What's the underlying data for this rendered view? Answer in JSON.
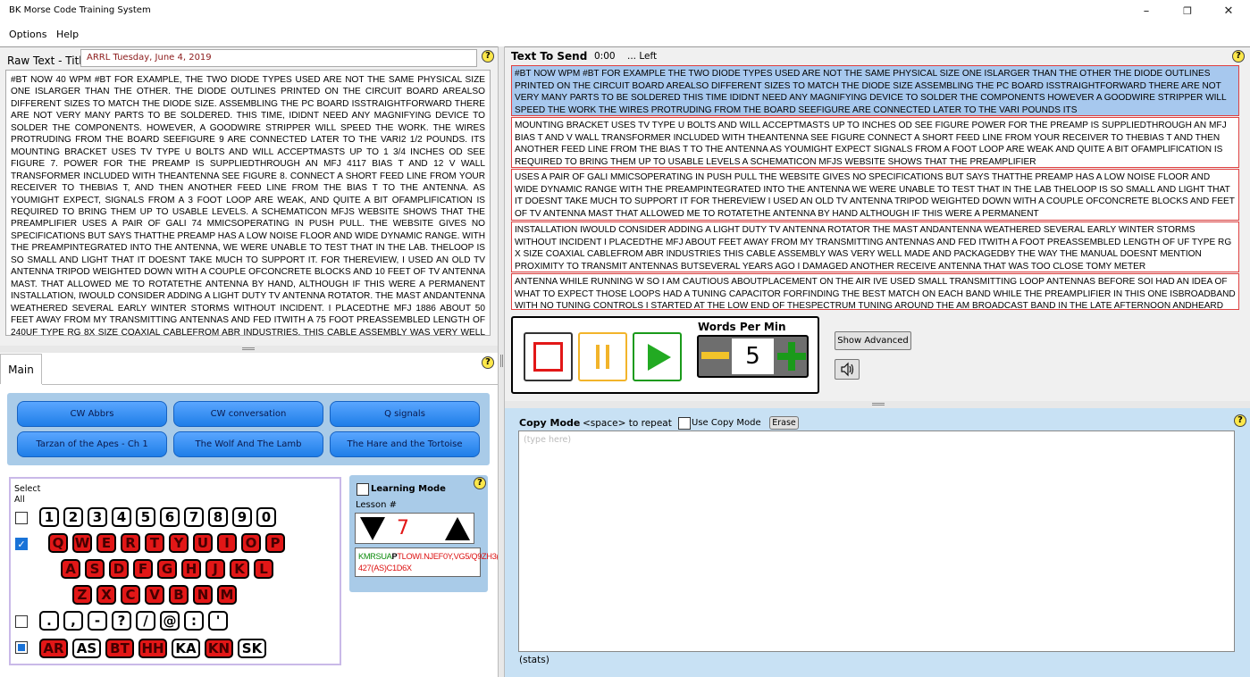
{
  "window": {
    "title": "BK Morse Code Training System",
    "minimize_icon": "–",
    "restore_icon": "❐",
    "close_icon": "✕"
  },
  "menu": [
    "Options",
    "Help"
  ],
  "help_glyph": "?",
  "raw": {
    "label": "Raw Text - Title",
    "title_value": "ARRL Tuesday, June 4, 2019",
    "text": "#BT NOW 40 WPM #BT FOR EXAMPLE, THE TWO DIODE TYPES USED ARE NOT THE SAME PHYSICAL SIZE ONE ISLARGER THAN THE OTHER. THE DIODE OUTLINES PRINTED ON THE CIRCUIT BOARD AREALSO DIFFERENT SIZES TO MATCH THE DIODE SIZE. ASSEMBLING THE PC BOARD ISSTRAIGHTFORWARD THERE ARE NOT VERY MANY PARTS TO BE SOLDERED. THIS TIME, IDIDNT NEED ANY MAGNIFYING DEVICE TO SOLDER THE COMPONENTS. HOWEVER, A GOODWIRE STRIPPER WILL SPEED THE WORK. THE WIRES PROTRUDING FROM THE BOARD SEEFIGURE 9 ARE CONNECTED LATER TO THE VARI2 1/2 POUNDS. ITS MOUNTING BRACKET USES TV TYPE U BOLTS AND WILL ACCEPTMASTS UP TO 1 3/4 INCHES OD SEE FIGURE 7. POWER FOR THE PREAMP IS SUPPLIEDTHROUGH AN MFJ 4117 BIAS T AND 12 V WALL TRANSFORMER INCLUDED WITH THEANTENNA SEE FIGURE 8. CONNECT A SHORT FEED LINE FROM YOUR RECEIVER TO THEBIAS T, AND THEN ANOTHER FEED LINE FROM THE BIAS T TO THE ANTENNA. AS YOUMIGHT EXPECT, SIGNALS FROM A 3 FOOT LOOP ARE WEAK, AND QUITE A BIT OFAMPLIFICATION IS REQUIRED TO BRING THEM UP TO USABLE LEVELS. A SCHEMATICON MFJS WEBSITE SHOWS THAT THE PREAMPLIFIER USES A PAIR OF GALI 74 MMICSOPERATING IN PUSH PULL. THE WEBSITE GIVES NO SPECIFICATIONS BUT SAYS THATTHE PREAMP HAS A LOW NOISE FLOOR AND WIDE DYNAMIC RANGE. WITH THE PREAMPINTEGRATED INTO THE ANTENNA, WE WERE UNABLE TO TEST THAT IN THE LAB. THELOOP IS SO SMALL AND LIGHT THAT IT DOESNT TAKE MUCH TO SUPPORT IT. FOR THEREVIEW, I USED AN OLD TV ANTENNA TRIPOD WEIGHTED DOWN WITH A COUPLE OFCONCRETE BLOCKS AND 10 FEET OF TV ANTENNA MAST. THAT ALLOWED ME TO ROTATETHE ANTENNA BY HAND, ALTHOUGH IF THIS WERE A PERMANENT INSTALLATION, IWOULD CONSIDER ADDING A LIGHT DUTY TV ANTENNA ROTATOR. THE MAST ANDANTENNA WEATHERED SEVERAL EARLY WINTER STORMS WITHOUT INCIDENT. I PLACEDTHE MFJ 1886 ABOUT 50 FEET AWAY FROM MY TRANSMITTING ANTENNAS AND FED ITWITH A 75 FOOT PREASSEMBLED LENGTH OF 240UF TYPE RG 8X SIZE COAXIAL CABLEFROM ABR INDUSTRIES. THIS CABLE ASSEMBLY WAS VERY WELL MADE AND PACKAGED,BY THE WAY. THE MANUAL DOESNT MENTION PROXIMITY TO TRANSMIT ANTENNAS, BUTSEVERAL YEARS AGO I DAMAGED ANOTHER RECEIVE ANTENNA THAT WAS TOO CLOSE TOMY 160"
  },
  "tabs": [
    "Main"
  ],
  "library": [
    "CW Abbrs",
    "CW conversation",
    "Q signals",
    "Tarzan of the Apes - Ch 1",
    "The Wolf And The Lamb",
    "The Hare and the Tortoise"
  ],
  "select_all": {
    "line1": "Select",
    "line2": "All"
  },
  "chk_mark": "✓",
  "keys": {
    "digits": [
      "1",
      "2",
      "3",
      "4",
      "5",
      "6",
      "7",
      "8",
      "9",
      "0"
    ],
    "row1": [
      "Q",
      "W",
      "E",
      "R",
      "T",
      "Y",
      "U",
      "I",
      "O",
      "P"
    ],
    "row2": [
      "A",
      "S",
      "D",
      "F",
      "G",
      "H",
      "J",
      "K",
      "L"
    ],
    "row3": [
      "Z",
      "X",
      "C",
      "V",
      "B",
      "N",
      "M"
    ],
    "punct": [
      ".",
      ",",
      "-",
      "?",
      "/",
      "@",
      ":",
      "'"
    ],
    "prosigns": [
      "AR",
      "AS",
      "BT",
      "HH",
      "KA",
      "KN",
      "SK"
    ],
    "prosigns_red": [
      true,
      false,
      true,
      true,
      false,
      true,
      false
    ]
  },
  "learning": {
    "label": "Learning Mode",
    "lesson_label": "Lesson #",
    "lesson": "7",
    "chars_green": "KMRSUA",
    "chars_bold": "P",
    "chars_red": "TLOWI.NJEF0Y,VG5/Q9ZH3(BT)8B?427(AS)C1D6X"
  },
  "send": {
    "label": "Text To Send",
    "time": "0:00",
    "left": "... Left",
    "paragraphs": [
      "#BT NOW WPM #BT FOR EXAMPLE THE TWO DIODE TYPES USED ARE NOT THE SAME PHYSICAL SIZE ONE ISLARGER THAN THE OTHER THE DIODE OUTLINES PRINTED ON THE CIRCUIT BOARD AREALSO DIFFERENT SIZES TO MATCH THE DIODE SIZE ASSEMBLING THE PC BOARD ISSTRAIGHTFORWARD THERE ARE NOT VERY MANY PARTS TO BE SOLDERED THIS TIME IDIDNT NEED ANY MAGNIFYING DEVICE TO SOLDER THE COMPONENTS HOWEVER A GOODWIRE STRIPPER WILL SPEED THE WORK THE WIRES PROTRUDING FROM THE BOARD SEEFIGURE ARE CONNECTED LATER TO THE VARI POUNDS ITS",
      "MOUNTING BRACKET USES TV TYPE U BOLTS AND WILL ACCEPTMASTS UP TO INCHES OD SEE FIGURE POWER FOR THE PREAMP IS SUPPLIEDTHROUGH AN MFJ BIAS T AND V WALL TRANSFORMER INCLUDED WITH THEANTENNA SEE FIGURE CONNECT A SHORT FEED LINE FROM YOUR RECEIVER TO THEBIAS T AND THEN ANOTHER FEED LINE FROM THE BIAS T TO THE ANTENNA AS YOUMIGHT EXPECT SIGNALS FROM A FOOT LOOP ARE WEAK AND QUITE A BIT OFAMPLIFICATION IS REQUIRED TO BRING THEM UP TO USABLE LEVELS A SCHEMATICON MFJS WEBSITE SHOWS THAT THE PREAMPLIFIER",
      "USES A PAIR OF GALI MMICSOPERATING IN PUSH PULL THE WEBSITE GIVES NO SPECIFICATIONS BUT SAYS THATTHE PREAMP HAS A LOW NOISE FLOOR AND WIDE DYNAMIC RANGE WITH THE PREAMPINTEGRATED INTO THE ANTENNA WE WERE UNABLE TO TEST THAT IN THE LAB THELOOP IS SO SMALL AND LIGHT THAT IT DOESNT TAKE MUCH TO SUPPORT IT FOR THEREVIEW I USED AN OLD TV ANTENNA TRIPOD WEIGHTED DOWN WITH A COUPLE OFCONCRETE BLOCKS AND FEET OF TV ANTENNA MAST THAT ALLOWED ME TO ROTATETHE ANTENNA BY HAND ALTHOUGH IF THIS WERE A PERMANENT",
      "INSTALLATION IWOULD CONSIDER ADDING A LIGHT DUTY TV ANTENNA ROTATOR THE MAST ANDANTENNA WEATHERED SEVERAL EARLY WINTER STORMS WITHOUT INCIDENT I PLACEDTHE MFJ ABOUT FEET AWAY FROM MY TRANSMITTING ANTENNAS AND FED ITWITH A FOOT PREASSEMBLED LENGTH OF UF TYPE RG X SIZE COAXIAL CABLEFROM ABR INDUSTRIES THIS CABLE ASSEMBLY WAS VERY WELL MADE AND PACKAGEDBY THE WAY THE MANUAL DOESNT MENTION PROXIMITY TO TRANSMIT ANTENNAS BUTSEVERAL YEARS AGO I DAMAGED ANOTHER RECEIVE ANTENNA THAT WAS TOO CLOSE TOMY METER",
      "ANTENNA WHILE RUNNING W SO I AM CAUTIOUS ABOUTPLACEMENT ON THE AIR IVE USED SMALL TRANSMITTING LOOP ANTENNAS BEFORE SOI HAD AN IDEA OF WHAT TO EXPECT THOSE LOOPS HAD A TUNING CAPACITOR FORFINDING THE BEST MATCH ON EACH BAND WHILE THE PREAMPLIFIER IN THIS ONE ISBROADBAND WITH NO TUNING CONTROLS I STARTED AT THE LOW END OF THESPECTRUM TUNING AROUND THE AM BROADCAST BAND IN THE LATE AFTERNOON ANDHEARD QUITE A FEW SIGNALS AS"
    ]
  },
  "wpm": {
    "label": "Words Per Min",
    "value": "5",
    "minus_icon": "minus-icon",
    "plus_icon": "plus-icon"
  },
  "buttons": {
    "show_advanced": "Show Advanced",
    "sound_icon": "speaker-icon"
  },
  "copy": {
    "label": "Copy Mode",
    "hint": "<space> to repeat",
    "use_label": "Use Copy Mode",
    "erase": "Erase",
    "placeholder": "(type here)",
    "stats": "(stats)"
  },
  "colors": {
    "accent": "#1a73d8",
    "key_red": "#e21717",
    "lib_blue": "#2a88f0",
    "panel_blue": "#a9cbe8"
  }
}
